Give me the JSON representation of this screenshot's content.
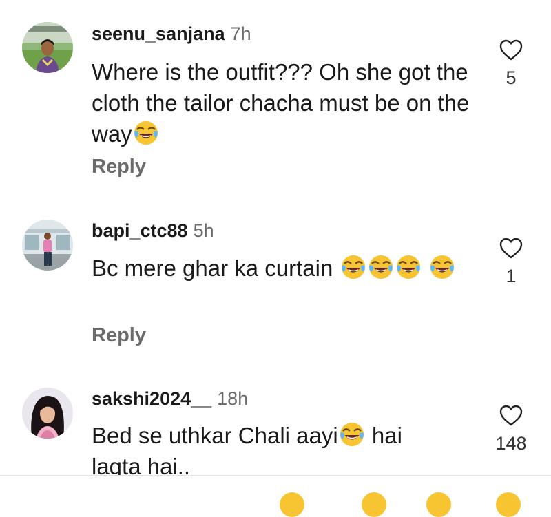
{
  "comments": [
    {
      "username": "seenu_sanjana",
      "time": "7h",
      "text_parts": [
        "Where is the outfit??? Oh she got the cloth the tailor chacha must be on the way"
      ],
      "likes": "5",
      "reply_label": "Reply"
    },
    {
      "username": "bapi_ctc88",
      "time": "5h",
      "text_parts": [
        "Bc mere ghar ka curtain "
      ],
      "likes": "1",
      "reply_label": "Reply"
    },
    {
      "username": "sakshi2024__",
      "time": "18h",
      "text_parts": [
        "Bed se uthkar Chali aayi",
        " hai lagta hai.."
      ],
      "likes": "148"
    }
  ],
  "icons": {
    "like": "heart-outline-icon",
    "emoji": "face-with-tears-of-joy-emoji"
  },
  "colors": {
    "text": "#1a1a1a",
    "secondary": "#6b6b6b",
    "emoji": "#f7c531"
  }
}
